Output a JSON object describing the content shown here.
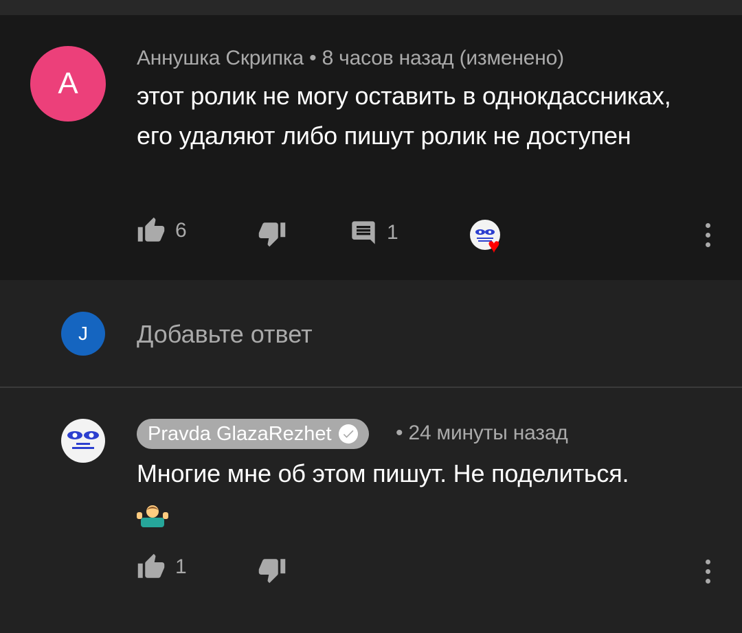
{
  "comments": [
    {
      "avatar_letter": "A",
      "avatar_color": "#ec407a",
      "author": "Аннушка Скрипка",
      "separator": "•",
      "time": "8 часов назад (изменено)",
      "text": "этот ролик не могу оставить в однокдассниках, его удаляют либо пишут ролик не доступен",
      "likes": "6",
      "replies": "1",
      "creator_heart": true
    },
    {
      "author": "Pravda GlazaRezhet",
      "verified": true,
      "separator": "•",
      "time": "24 минуты назад",
      "text": "Многие мне об этом пишут. Не поделиться.",
      "emoji_icon": "person-shrugging-emoji",
      "likes": "1"
    }
  ],
  "reply_box": {
    "avatar_letter": "J",
    "avatar_color": "#1565c0",
    "placeholder": "Добавьте ответ"
  },
  "icons": [
    "thumbs-up-icon",
    "thumbs-down-icon",
    "reply-icon",
    "more-vert-icon",
    "heart-icon",
    "verified-check-icon"
  ],
  "colors": {
    "background": "#222222",
    "highlighted_comment_bg": "#181818",
    "secondary_text": "#aaaaaa",
    "heart": "#ff0000"
  }
}
